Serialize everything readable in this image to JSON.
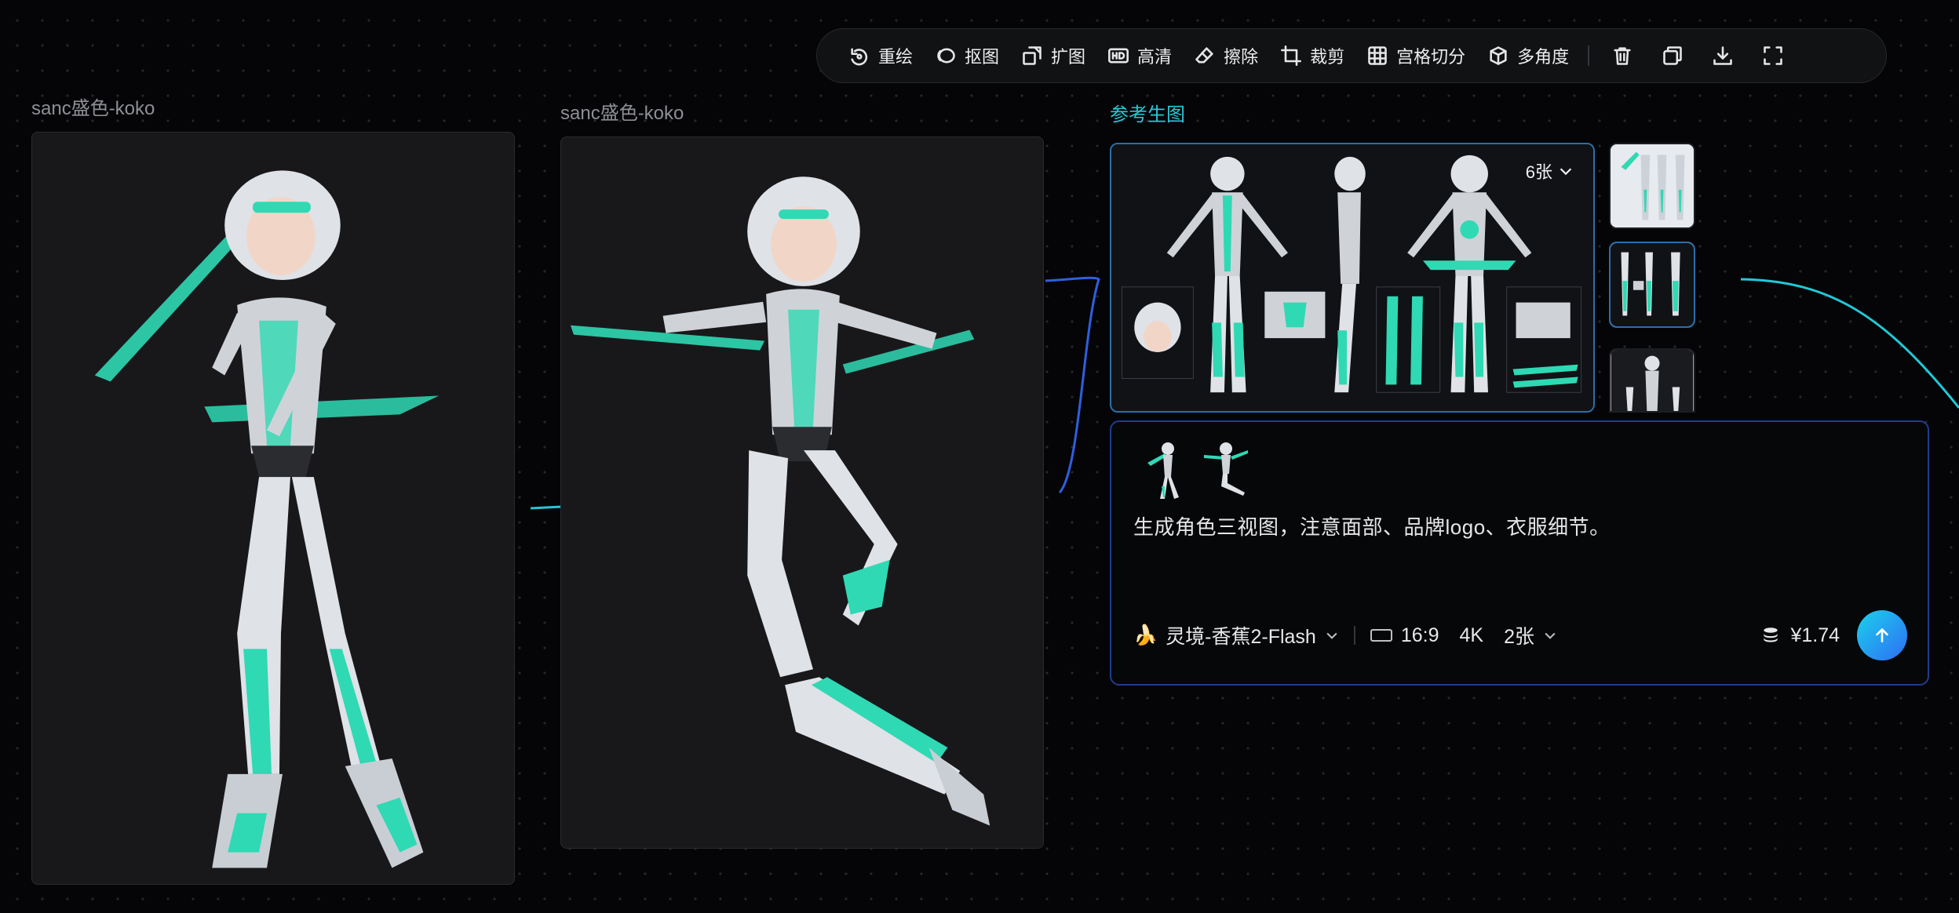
{
  "toolbar": {
    "items": [
      {
        "label": "重绘",
        "icon": "redraw-icon"
      },
      {
        "label": "抠图",
        "icon": "cutout-icon"
      },
      {
        "label": "扩图",
        "icon": "expand-icon"
      },
      {
        "label": "高清",
        "icon": "hd-icon"
      },
      {
        "label": "擦除",
        "icon": "eraser-icon"
      },
      {
        "label": "裁剪",
        "icon": "crop-icon"
      },
      {
        "label": "宫格切分",
        "icon": "grid-split-icon"
      },
      {
        "label": "多角度",
        "icon": "multi-angle-icon"
      }
    ],
    "actions": [
      "delete-icon",
      "duplicate-icon",
      "download-icon",
      "fullscreen-icon"
    ]
  },
  "nodes": {
    "image1": {
      "label": "sanc盛色-koko"
    },
    "image2": {
      "label": "sanc盛色-koko"
    },
    "reference": {
      "label": "参考生图",
      "count_label": "6张"
    }
  },
  "prompt": {
    "text": "生成角色三视图，注意面部、品牌logo、衣服细节。",
    "model_emoji": "🍌",
    "model": "灵境-香蕉2-Flash",
    "aspect_ratio": "16:9",
    "resolution": "4K",
    "count": "2张",
    "cost": "¥1.74"
  },
  "colors": {
    "accent": "#27c9d6",
    "suit_teal": "#2fd9b4",
    "panel_border": "#1f3d8f"
  }
}
